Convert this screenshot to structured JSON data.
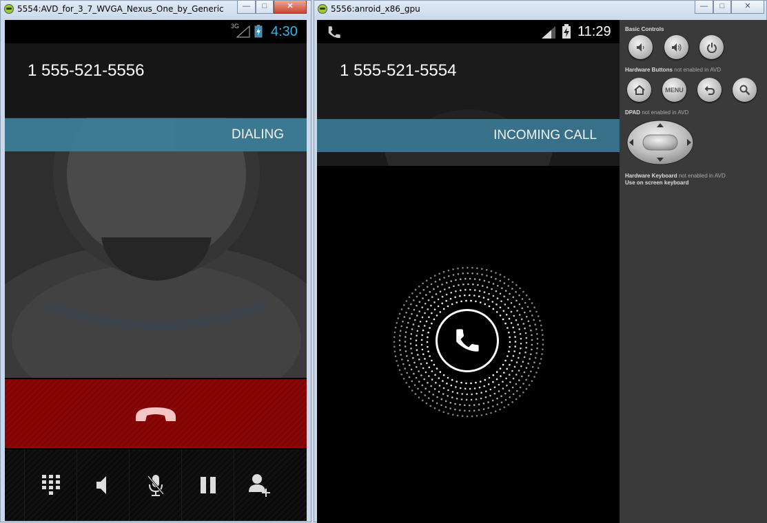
{
  "window1": {
    "title": "5554:AVD_for_3_7_WVGA_Nexus_One_by_Generic",
    "statusbar": {
      "network": "3G",
      "time": "4:30"
    },
    "phone_number": "1 555-521-5556",
    "call_state": "DIALING",
    "buttons": [
      "end-call",
      "dialpad",
      "speaker",
      "mute",
      "hold",
      "add-call"
    ]
  },
  "window2": {
    "title": "5556:anroid_x86_gpu",
    "statusbar": {
      "time": "11:29"
    },
    "phone_number": "1 555-521-5554",
    "call_state": "INCOMING CALL"
  },
  "controls": {
    "basic_controls": "Basic Controls",
    "hardware_buttons": "Hardware Buttons",
    "hardware_buttons_note": "not enabled in AVD",
    "menu_label": "MENU",
    "dpad": "DPAD",
    "dpad_note": "not enabled in AVD",
    "hardware_keyboard": "Hardware Keyboard",
    "hardware_keyboard_note": "not enabled in AVD",
    "onscreen_keyboard": "Use on screen keyboard"
  },
  "colors": {
    "accent_blue": "#33b5e5",
    "callband": "#3c7d97",
    "endcall_red": "#8c0606"
  }
}
